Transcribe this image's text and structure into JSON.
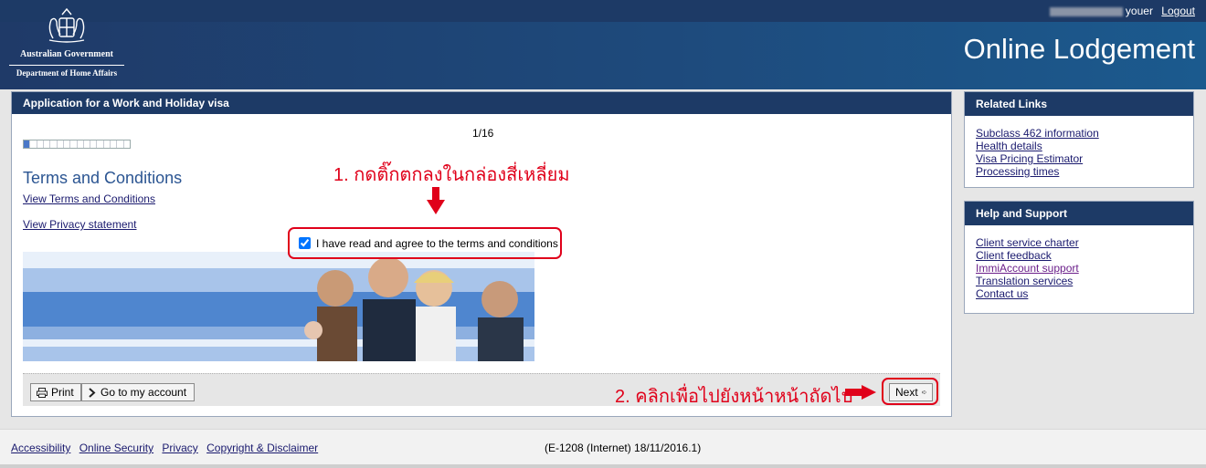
{
  "header": {
    "gov_name": "Australian Government",
    "dept_name": "Department of Home Affairs",
    "user_suffix": "youer",
    "logout_label": "Logout",
    "site_title": "Online Lodgement"
  },
  "main": {
    "panel_title": "Application for a Work and Holiday visa",
    "step_count": "1/16",
    "progress": {
      "current": 1,
      "total": 16
    },
    "heading": "Terms and Conditions",
    "link_terms": "View Terms and Conditions",
    "link_privacy": "View Privacy statement",
    "agree_label": "I have read and agree to the terms and conditions",
    "agree_checked": true,
    "annotation_1": "1. กดติ๊กตกลงในกล่องสี่เหลี่ยม",
    "annotation_2": "2. คลิกเพื่อไปยังหน้าหน้าถัดไป",
    "buttons": {
      "print": "Print",
      "account": "Go to my account",
      "next": "Next"
    }
  },
  "related_links": {
    "title": "Related Links",
    "items": [
      {
        "label": "Subclass 462 information"
      },
      {
        "label": "Health details"
      },
      {
        "label": "Visa Pricing Estimator"
      },
      {
        "label": "Processing times"
      }
    ]
  },
  "help_support": {
    "title": "Help and Support",
    "items": [
      {
        "label": "Client service charter"
      },
      {
        "label": "Client feedback"
      },
      {
        "label": "ImmiAccount support"
      },
      {
        "label": "Translation services"
      },
      {
        "label": "Contact us"
      }
    ]
  },
  "footer": {
    "links": [
      "Accessibility",
      "Online Security",
      "Privacy",
      "Copyright & Disclaimer"
    ],
    "version": "(E-1208 (Internet) 18/11/2016.1)"
  },
  "colors": {
    "header": "#1d3a66",
    "annotation": "#e0001a",
    "heading": "#2b5592",
    "progress_fill": "#4a78c8"
  },
  "icons": [
    "coat-of-arms-icon",
    "printer-icon",
    "chevron-right-icon",
    "arrow-right-icon",
    "checkbox-icon"
  ]
}
